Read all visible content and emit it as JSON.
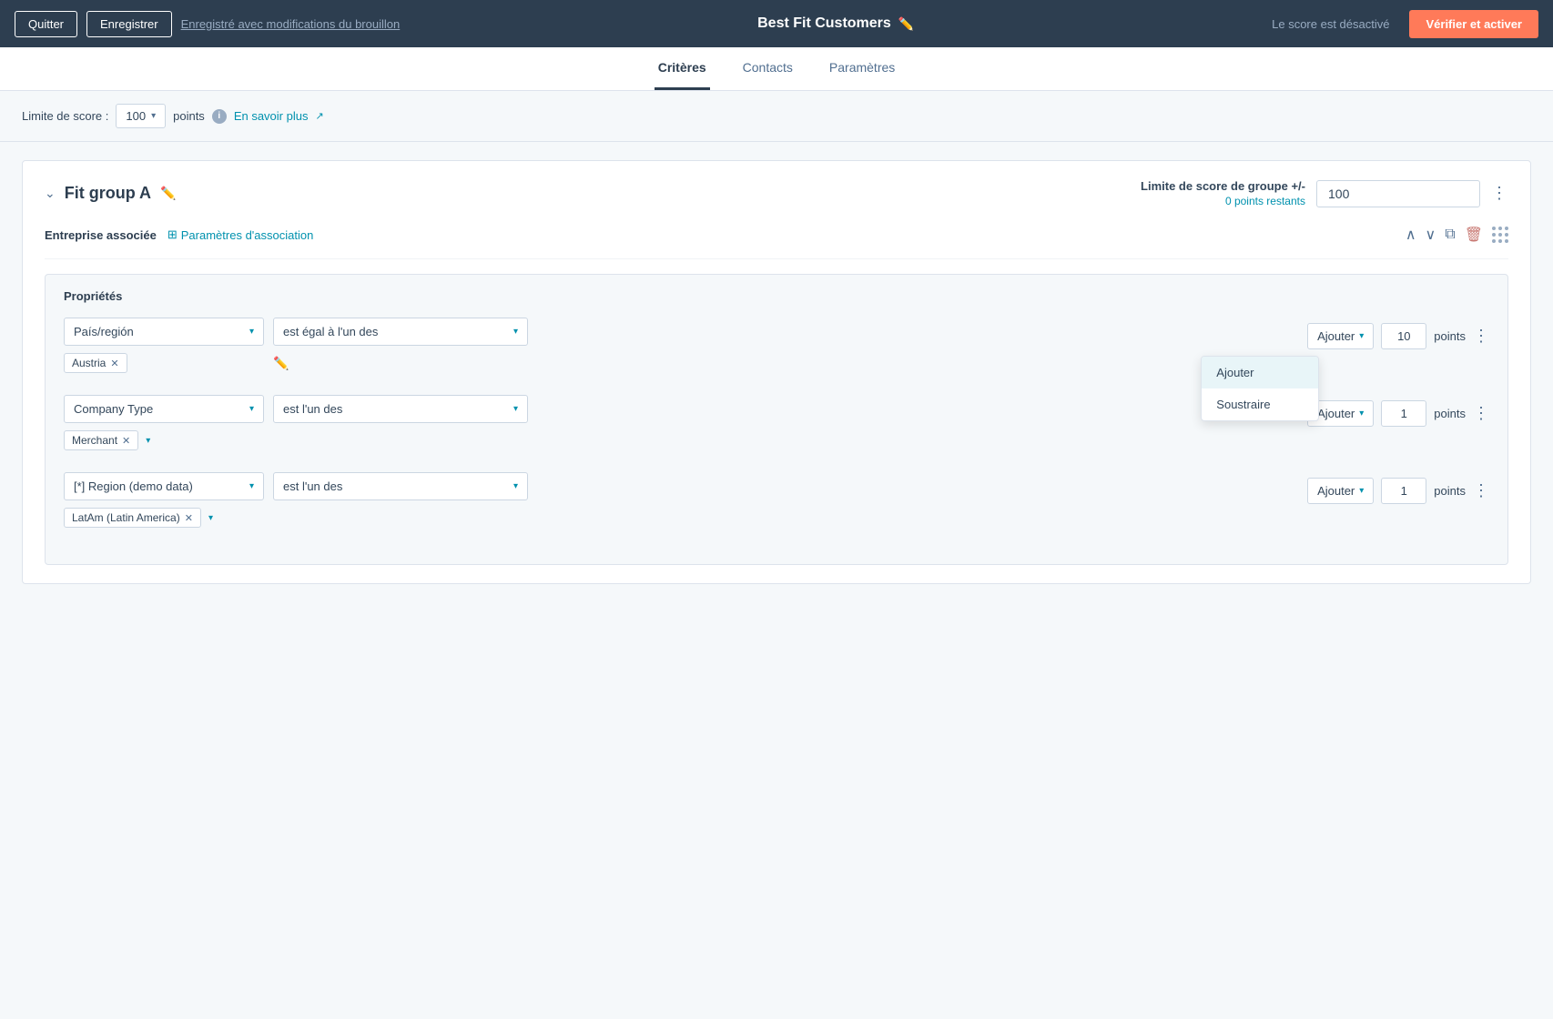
{
  "header": {
    "quit_label": "Quitter",
    "save_label": "Enregistrer",
    "saved_status": "Enregistré avec modifications du brouillon",
    "title": "Best Fit Customers",
    "score_disabled": "Le score est désactivé",
    "activate_label": "Vérifier et activer"
  },
  "tabs": [
    {
      "label": "Critères",
      "active": true
    },
    {
      "label": "Contacts",
      "active": false
    },
    {
      "label": "Paramètres",
      "active": false
    }
  ],
  "score_limit": {
    "label": "Limite de score :",
    "value": "100",
    "unit": "points",
    "learn_more": "En savoir plus"
  },
  "group": {
    "title": "Fit group A",
    "score_limit_label": "Limite de score de groupe +/-",
    "score_value": "100",
    "score_remaining": "0 points restants"
  },
  "association": {
    "label": "Entreprise associée",
    "link_label": "Paramètres d'association"
  },
  "properties": {
    "title": "Propriétés",
    "items": [
      {
        "field": "País/región",
        "condition": "est égal à l'un des",
        "tags": [
          {
            "label": "Austria"
          }
        ],
        "points": "10",
        "ajouter": "Ajouter"
      },
      {
        "field": "Company Type",
        "condition": "est l'un des",
        "tags": [
          {
            "label": "Merchant"
          }
        ],
        "points": "1",
        "ajouter": "Ajouter"
      },
      {
        "field": "[*] Region (demo data)",
        "condition": "est l'un des",
        "tags": [
          {
            "label": "LatAm (Latin America)"
          }
        ],
        "points": "1",
        "ajouter": "Ajouter"
      }
    ]
  },
  "dropdown": {
    "items": [
      {
        "label": "Ajouter",
        "active": true
      },
      {
        "label": "Soustraire",
        "active": false
      }
    ]
  }
}
